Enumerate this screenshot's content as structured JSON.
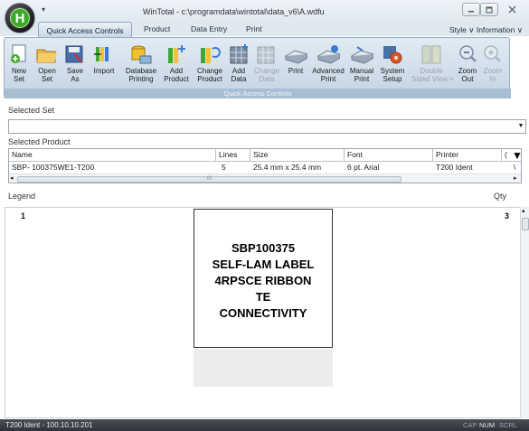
{
  "window": {
    "title": "WinTotal - c:\\programdata\\wintotal\\data_v6\\A.wdfu",
    "quick_access_arrow": "▾",
    "logo_letter": "H"
  },
  "tabs": [
    "Quick Access Controls",
    "Product",
    "Data Entry",
    "Print"
  ],
  "style_menu": "Style ∨ Information ∨",
  "ribbon": {
    "group_label": "Quick Access Controls",
    "items": [
      {
        "line1": "New",
        "line2": "Set",
        "disabled": false,
        "icon": "new-set-icon"
      },
      {
        "line1": "Open",
        "line2": "Set",
        "disabled": false,
        "icon": "open-set-icon"
      },
      {
        "line1": "Save",
        "line2": "As",
        "disabled": false,
        "icon": "save-as-icon"
      },
      {
        "line1": "Import",
        "line2": "",
        "disabled": false,
        "icon": "import-icon"
      },
      {
        "line1": "Database",
        "line2": "Printing",
        "disabled": false,
        "icon": "database-printing-icon"
      },
      {
        "line1": "Add",
        "line2": "Product",
        "disabled": false,
        "icon": "add-product-icon"
      },
      {
        "line1": "Change",
        "line2": "Product",
        "disabled": false,
        "icon": "change-product-icon"
      },
      {
        "line1": "Add",
        "line2": "Data",
        "disabled": false,
        "icon": "add-data-icon"
      },
      {
        "line1": "Change",
        "line2": "Data",
        "disabled": true,
        "icon": "change-data-icon"
      },
      {
        "line1": "Print",
        "line2": "",
        "disabled": false,
        "icon": "print-icon"
      },
      {
        "line1": "Advanced",
        "line2": "Print",
        "disabled": false,
        "icon": "advanced-print-icon"
      },
      {
        "line1": "Manual",
        "line2": "Print",
        "disabled": false,
        "icon": "manual-print-icon"
      },
      {
        "line1": "System",
        "line2": "Setup",
        "disabled": false,
        "icon": "system-setup-icon"
      },
      {
        "line1": "Double",
        "line2": "Sided View ˅",
        "disabled": true,
        "icon": "double-sided-view-icon"
      },
      {
        "line1": "Zoom",
        "line2": "Out",
        "disabled": false,
        "icon": "zoom-out-icon"
      },
      {
        "line1": "Zoom",
        "line2": "In",
        "disabled": true,
        "icon": "zoom-in-icon"
      }
    ]
  },
  "selected_set": {
    "label": "Selected Set",
    "value": ""
  },
  "selected_product": {
    "label": "Selected Product",
    "columns": [
      "Name",
      "Lines",
      "Size",
      "Font",
      "Printer",
      "("
    ],
    "rows": [
      [
        "SBP- 100375WE1-T200",
        "5",
        "25.4 mm x 25.4 mm",
        "6 pt. Arial",
        "T200 Ident",
        "\\"
      ]
    ],
    "scroll_grip": "III"
  },
  "legend": {
    "label": "Legend",
    "qty_label": "Qty"
  },
  "preview": {
    "left_number": "1",
    "right_number": "3",
    "label_lines": [
      "SBP100375",
      "SELF-LAM LABEL",
      "4RPSCE RIBBON",
      "TE",
      "CONNECTIVITY"
    ]
  },
  "status": {
    "left": "T200 Ident - 100.10.10.201",
    "indicators": [
      "CAP",
      "NUM",
      "SCRL"
    ]
  },
  "colors": {
    "accent_green": "#3fa92a",
    "ribbon_blue": "#c4d3e3",
    "statusbar": "#2f3338"
  }
}
